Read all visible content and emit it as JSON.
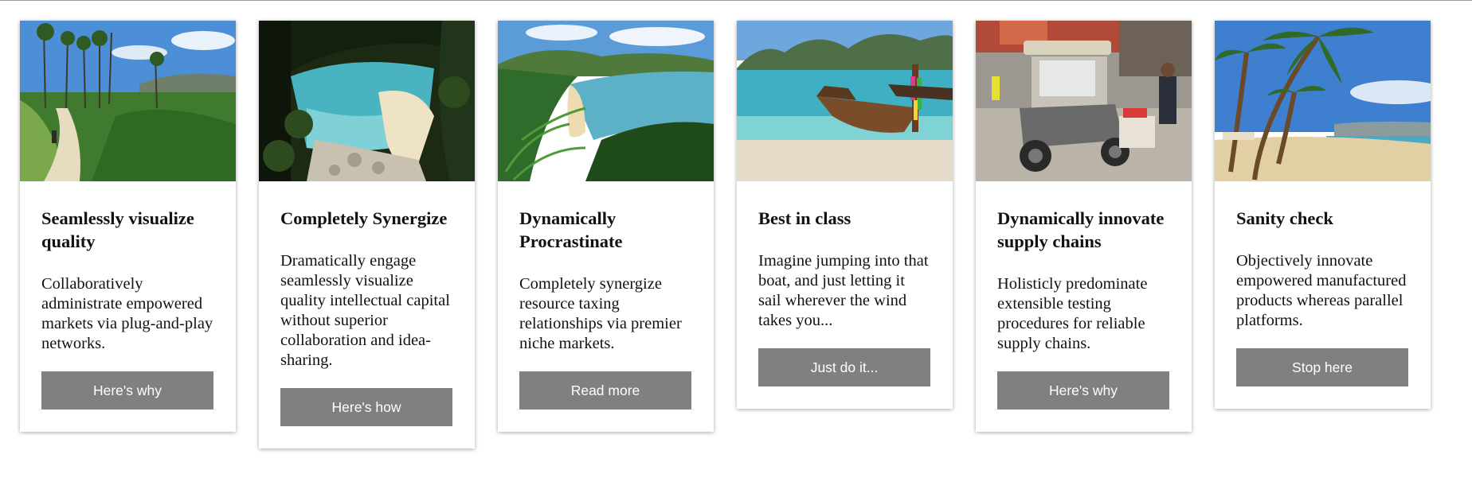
{
  "cards": [
    {
      "image": "coastal-trail-photo",
      "title": "Seamlessly visualize quality",
      "description": "Collaboratively administrate empowered markets via plug-and-play networks.",
      "button": "Here's why"
    },
    {
      "image": "hidden-cove-photo",
      "title": "Completely Synergize",
      "description": "Dramatically engage seamlessly visualize quality intellectual capital without superior collaboration and idea-sharing.",
      "button": "Here's how"
    },
    {
      "image": "jungle-bay-photo",
      "title": "Dynamically Procrastinate",
      "description": "Completely synergize resource taxing relationships via premier niche markets.",
      "button": "Read more"
    },
    {
      "image": "longtail-boat-photo",
      "title": "Best in class",
      "description": "Imagine jumping into that boat, and just letting it sail wherever the wind takes you...",
      "button": "Just do it..."
    },
    {
      "image": "street-tuk-tuk-photo",
      "title": "Dynamically innovate supply chains",
      "description": "Holisticly predominate extensible testing procedures for reliable supply chains.",
      "button": "Here's why"
    },
    {
      "image": "palm-beach-photo",
      "title": "Sanity check",
      "description": "Objectively innovate empowered manufactured products whereas parallel platforms.",
      "button": "Stop here"
    }
  ],
  "colors": {
    "button_bg": "#808080",
    "button_text": "#ffffff",
    "card_bg": "#ffffff"
  }
}
